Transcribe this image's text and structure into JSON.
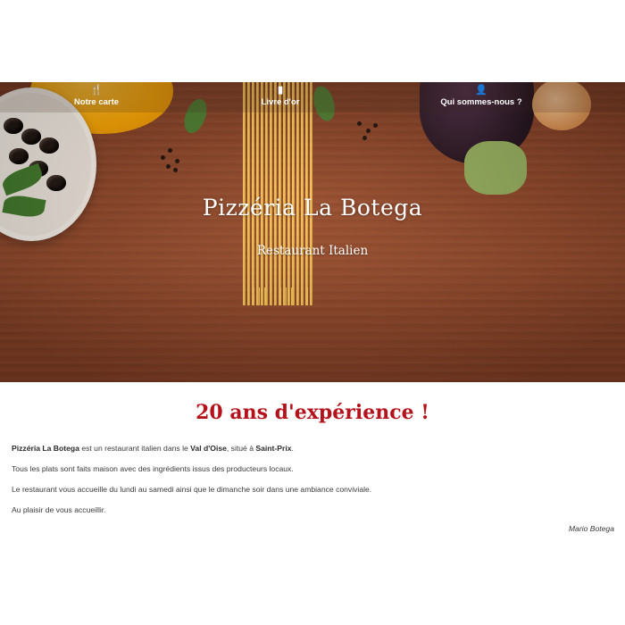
{
  "nav": {
    "items": [
      {
        "icon": "fork-knife-icon",
        "glyph": "🍴",
        "label": "Notre carte"
      },
      {
        "icon": "book-icon",
        "glyph": "▮",
        "label": "Livre d'or"
      },
      {
        "icon": "user-icon",
        "glyph": "👤",
        "label": "Qui sommes-nous ?"
      }
    ]
  },
  "hero": {
    "title": "Pizzéria La Botega",
    "subtitle": "Restaurant Italien"
  },
  "content": {
    "headline": "20 ans d'expérience !",
    "p1_bold1": "Pizzéria La Botega",
    "p1_text1": " est un restaurant italien dans le ",
    "p1_bold2": "Val d'Oise",
    "p1_text2": ", situé à ",
    "p1_bold3": "Saint-Prix",
    "p1_text3": ".",
    "p2": "Tous les plats sont faits maison avec des ingrédients issus des producteurs locaux.",
    "p3": "Le restaurant vous accueille du lundi au samedi ainsi que le dimanche soir dans une ambiance conviviale.",
    "p4": "Au plaisir de vous accueillir.",
    "signature": "Mario Botega"
  },
  "colors": {
    "headline": "#b5121b",
    "wood": "#8a4428"
  }
}
